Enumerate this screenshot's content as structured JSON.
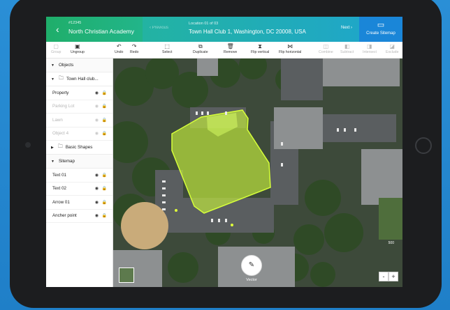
{
  "header": {
    "back_icon": "chevron-left-icon",
    "id": "#12345",
    "account_name": "North Christian Academy",
    "prev_label": "Previous",
    "location_label": "Location 01 of 03",
    "location_name": "Town Hall Club 1, Washington, DC 20008, USA",
    "next_label": "Next",
    "create_label": "Create Sitemap"
  },
  "toolbar": {
    "items": [
      {
        "label": "Group",
        "icon": "group-icon",
        "enabled": false
      },
      {
        "label": "Ungroup",
        "icon": "ungroup-icon",
        "enabled": true
      },
      {
        "label": "Undo",
        "icon": "undo-icon",
        "enabled": true
      },
      {
        "label": "Redo",
        "icon": "redo-icon",
        "enabled": true
      },
      {
        "label": "Select",
        "icon": "select-icon",
        "enabled": true
      },
      {
        "label": "Duplicate",
        "icon": "duplicate-icon",
        "enabled": true
      },
      {
        "label": "Remove",
        "icon": "trash-icon",
        "enabled": true
      },
      {
        "label": "Flip vertical",
        "icon": "flip-vertical-icon",
        "enabled": true
      },
      {
        "label": "Flip horizontal",
        "icon": "flip-horizontal-icon",
        "enabled": true
      },
      {
        "label": "Combine",
        "icon": "combine-icon",
        "enabled": false
      },
      {
        "label": "Subtract",
        "icon": "subtract-icon",
        "enabled": false
      },
      {
        "label": "Intersect",
        "icon": "intersect-icon",
        "enabled": false
      },
      {
        "label": "Exclude",
        "icon": "exclude-icon",
        "enabled": false
      }
    ]
  },
  "sidebar": {
    "objects_label": "Objects",
    "group_label": "Town Hall club...",
    "object_rows": [
      {
        "label": "Property",
        "visible": true
      },
      {
        "label": "Parking Lot",
        "visible": false
      },
      {
        "label": "Lawn",
        "visible": false
      },
      {
        "label": "Object 4",
        "visible": false
      }
    ],
    "basic_shapes_label": "Basic Shapes",
    "sitemap_label": "Sitemap",
    "sitemap_rows": [
      {
        "label": "Text 01"
      },
      {
        "label": "Text 02"
      },
      {
        "label": "Arrow 01"
      },
      {
        "label": "Ancher point"
      }
    ]
  },
  "map": {
    "vector_label": "Vector",
    "scale_label": "500",
    "zoom_out": "-",
    "zoom_in": "+",
    "polygon_color": "#c6f03c"
  }
}
